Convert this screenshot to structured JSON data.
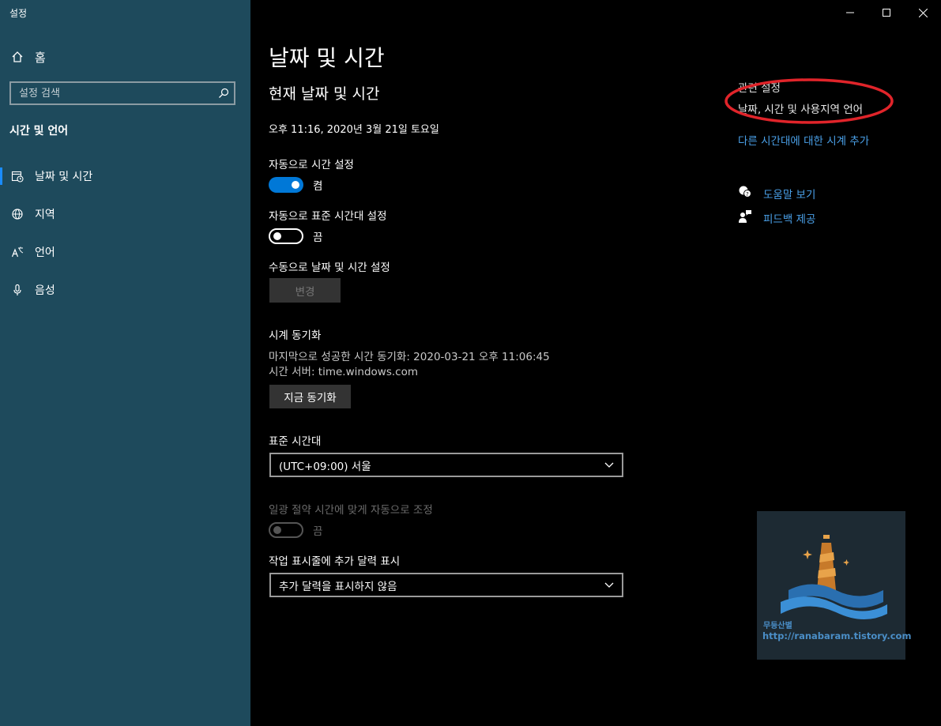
{
  "app": {
    "title": "설정"
  },
  "sidebar": {
    "home_label": "홈",
    "search_placeholder": "설정 검색",
    "section_title": "시간 및 언어",
    "items": [
      {
        "label": "날짜 및 시간",
        "icon": "calendar-clock-icon",
        "active": true
      },
      {
        "label": "지역",
        "icon": "globe-icon"
      },
      {
        "label": "언어",
        "icon": "language-icon"
      },
      {
        "label": "음성",
        "icon": "microphone-icon"
      }
    ]
  },
  "main": {
    "page_title": "날짜 및 시간",
    "section_title": "현재 날짜 및 시간",
    "current_datetime": "오후 11:16, 2020년 3월 21일 토요일",
    "auto_time": {
      "label": "자동으로 시간 설정",
      "state": "켬",
      "on": true
    },
    "auto_timezone": {
      "label": "자동으로 표준 시간대 설정",
      "state": "끔",
      "on": false
    },
    "manual": {
      "label": "수동으로 날짜 및 시간 설정",
      "button": "변경"
    },
    "sync": {
      "title": "시계 동기화",
      "last_sync": "마지막으로 성공한 시간 동기화: 2020-03-21 오후 11:06:45",
      "server": "시간 서버: time.windows.com",
      "button": "지금 동기화"
    },
    "timezone": {
      "label": "표준 시간대",
      "value": "(UTC+09:00) 서울"
    },
    "dst": {
      "label": "일광 절약 시간에 맞게 자동으로 조정",
      "state": "끔"
    },
    "taskbar_calendar": {
      "label": "작업 표시줄에 추가 달력 표시",
      "value": "추가 달력을 표시하지 않음"
    }
  },
  "related": {
    "title": "관련 설정",
    "link1": "날짜, 시간 및 사용지역 언어",
    "link2": "다른 시간대에 대한 시계 추가",
    "help": "도움말 보기",
    "feedback": "피드백 제공"
  },
  "watermark": {
    "name": "무등산별",
    "url": "http://ranabaram.tistory.com"
  },
  "colors": {
    "sidebar_bg": "#1e4a5c",
    "accent": "#0078d7",
    "link": "#4aa0e8",
    "annotation": "#e0242a"
  }
}
